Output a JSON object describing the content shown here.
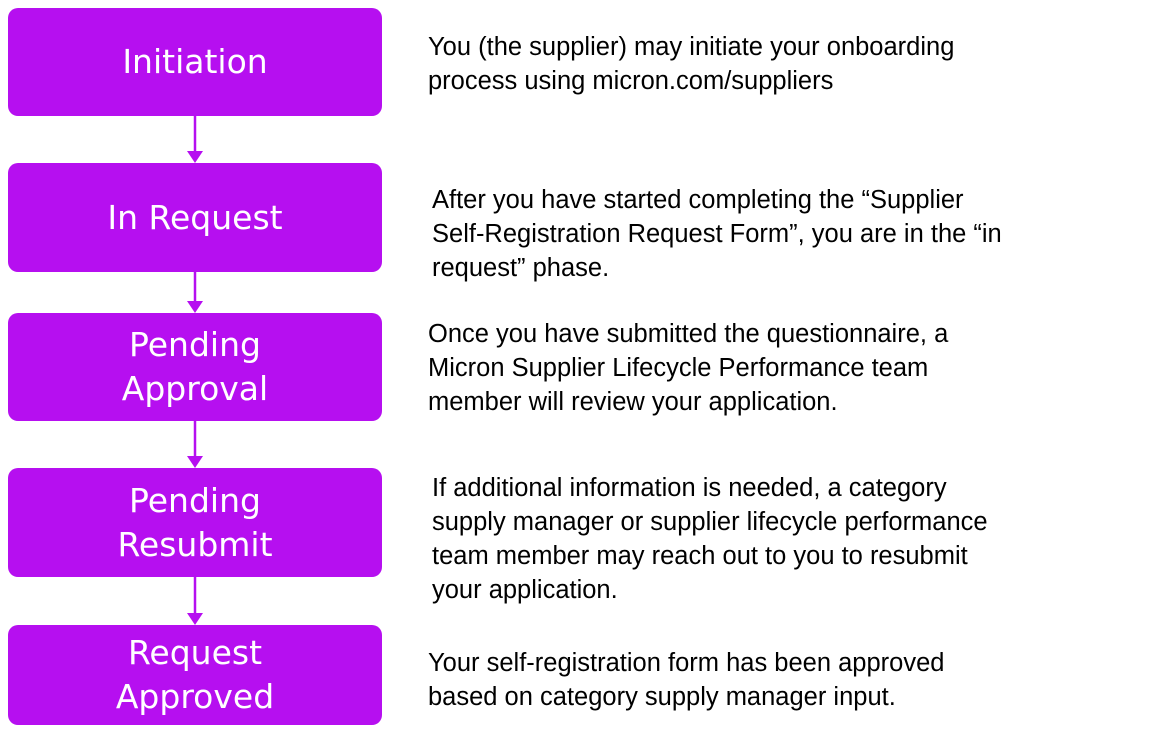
{
  "colors": {
    "stage_fill": "#b60ff0",
    "connector": "#b60ff0",
    "stage_text": "#ffffff",
    "desc_text": "#000000"
  },
  "stages": [
    {
      "label_lines": [
        "Initiation"
      ],
      "description_lines": [
        "You (the supplier) may initiate your onboarding",
        "process using micron.com/suppliers"
      ]
    },
    {
      "label_lines": [
        "In Request"
      ],
      "description_lines": [
        "After you have started completing the “Supplier",
        "Self-Registration Request Form”, you are in the “in",
        "request” phase."
      ]
    },
    {
      "label_lines": [
        "Pending",
        "Approval"
      ],
      "description_lines": [
        "Once you have submitted the questionnaire, a",
        "Micron Supplier Lifecycle Performance team",
        "member will review your application."
      ]
    },
    {
      "label_lines": [
        "Pending",
        "Resubmit"
      ],
      "description_lines": [
        "If additional information is needed, a category",
        "supply manager or supplier lifecycle performance",
        "team member may reach out to you to resubmit",
        "your application."
      ]
    },
    {
      "label_lines": [
        "Request",
        "Approved"
      ],
      "description_lines": [
        "Your self-registration form has been approved",
        "based on category supply manager input."
      ]
    }
  ]
}
